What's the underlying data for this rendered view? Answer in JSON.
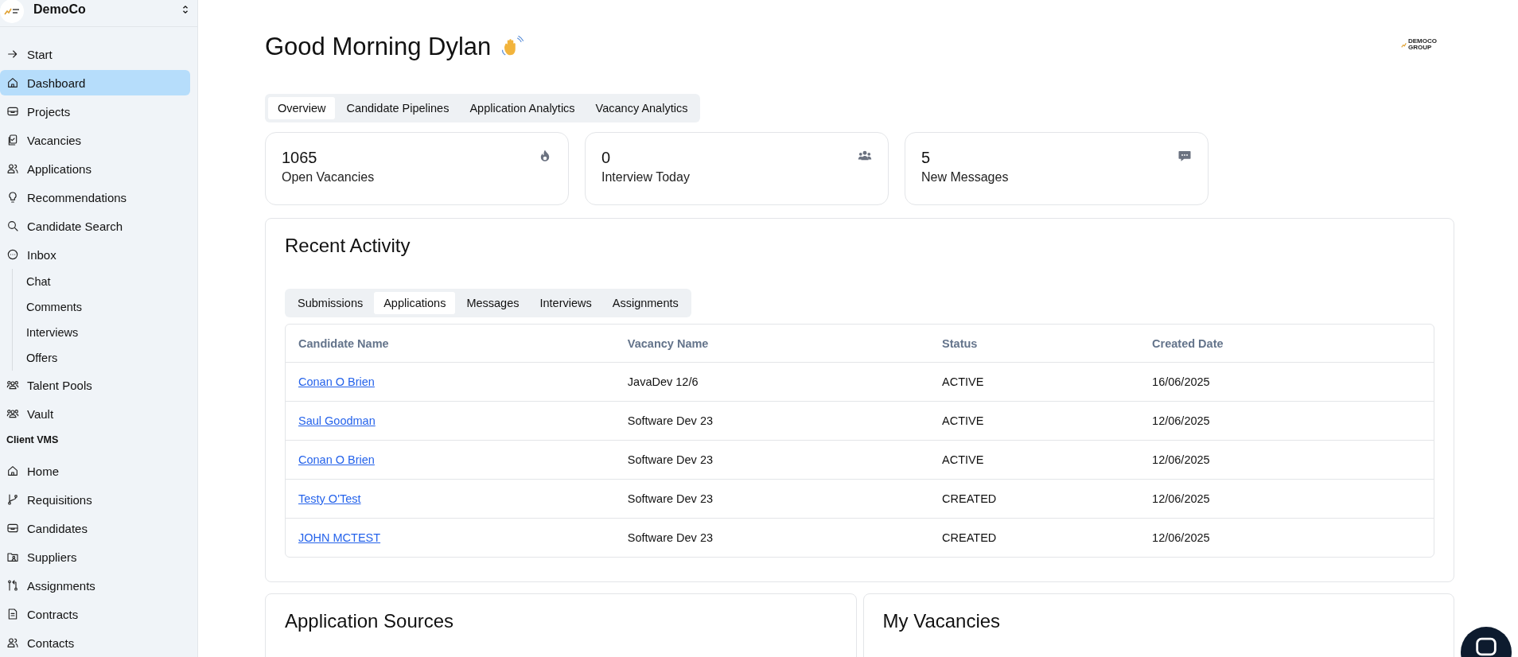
{
  "sidebar": {
    "org": {
      "name": "DemoCo"
    },
    "sections": [
      {
        "items": [
          {
            "label": "Start",
            "kind": "arrow",
            "selected": false
          },
          {
            "label": "Dashboard",
            "kind": "home",
            "selected": true
          },
          {
            "label": "Projects",
            "kind": "tray",
            "selected": false
          },
          {
            "label": "Vacancies",
            "kind": "clipboard",
            "selected": false
          },
          {
            "label": "Applications",
            "kind": "users",
            "selected": false
          },
          {
            "label": "Recommendations",
            "kind": "bulb",
            "selected": false
          },
          {
            "label": "Candidate Search",
            "kind": "search",
            "selected": false
          },
          {
            "label": "Inbox",
            "kind": "chat",
            "selected": false,
            "children": [
              {
                "label": "Chat",
                "selected": false
              },
              {
                "label": "Comments",
                "selected": false
              },
              {
                "label": "Interviews",
                "selected": false
              },
              {
                "label": "Offers",
                "selected": false
              }
            ]
          },
          {
            "label": "Talent Pools",
            "kind": "group",
            "selected": false
          },
          {
            "label": "Vault",
            "kind": "group",
            "selected": false
          }
        ]
      },
      {
        "title": "Client VMS",
        "items": [
          {
            "label": "Home",
            "kind": "home",
            "selected": false
          },
          {
            "label": "Requisitions",
            "kind": "branch",
            "selected": false
          },
          {
            "label": "Candidates",
            "kind": "tray",
            "selected": false
          },
          {
            "label": "Suppliers",
            "kind": "folder",
            "selected": false
          },
          {
            "label": "Assignments",
            "kind": "swap",
            "selected": false
          },
          {
            "label": "Contracts",
            "kind": "document",
            "selected": false
          },
          {
            "label": "Contacts",
            "kind": "users",
            "selected": false
          }
        ]
      }
    ]
  },
  "header": {
    "greeting": "Good Morning Dylan",
    "logo_text": "DEMOCO GROUP"
  },
  "tabs": [
    {
      "label": "Overview",
      "selected": true
    },
    {
      "label": "Candidate Pipelines",
      "selected": false
    },
    {
      "label": "Application Analytics",
      "selected": false
    },
    {
      "label": "Vacancy Analytics",
      "selected": false
    }
  ],
  "stats": [
    {
      "value": "1065",
      "label": "Open Vacancies",
      "kind": "fire"
    },
    {
      "value": "0",
      "label": "Interview Today",
      "kind": "people"
    },
    {
      "value": "5",
      "label": "New Messages",
      "kind": "message"
    }
  ],
  "recent_activity": {
    "title": "Recent Activity",
    "tabs": [
      {
        "label": "Submissions",
        "selected": false
      },
      {
        "label": "Applications",
        "selected": true
      },
      {
        "label": "Messages",
        "selected": false
      },
      {
        "label": "Interviews",
        "selected": false
      },
      {
        "label": "Assignments",
        "selected": false
      }
    ],
    "table": {
      "columns": [
        "Candidate Name",
        "Vacancy Name",
        "Status",
        "Created Date"
      ],
      "rows": [
        [
          "Conan O Brien",
          "JavaDev 12/6",
          "ACTIVE",
          "16/06/2025"
        ],
        [
          "Saul Goodman",
          "Software Dev 23",
          "ACTIVE",
          "12/06/2025"
        ],
        [
          "Conan O Brien",
          "Software Dev 23",
          "ACTIVE",
          "12/06/2025"
        ],
        [
          "Testy O'Test",
          "Software Dev 23",
          "CREATED",
          "12/06/2025"
        ],
        [
          "JOHN MCTEST",
          "Software Dev 23",
          "CREATED",
          "12/06/2025"
        ]
      ]
    }
  },
  "panels": [
    {
      "title": "Application Sources"
    },
    {
      "title": "My Vacancies"
    }
  ]
}
